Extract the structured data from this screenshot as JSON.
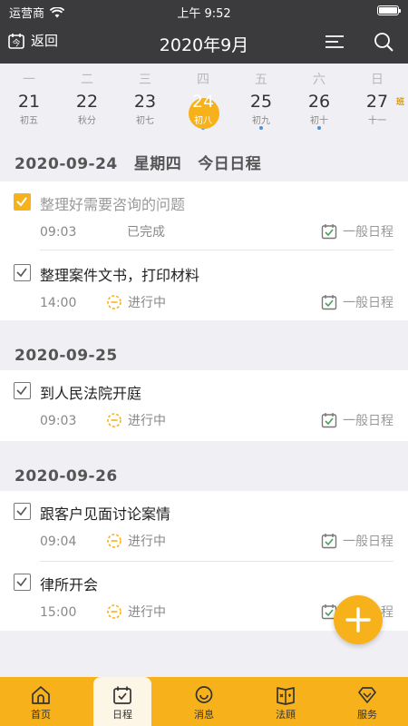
{
  "status": {
    "carrier": "运营商",
    "time": "上午 9:52"
  },
  "nav": {
    "back_label": "返回",
    "title": "2020年9月"
  },
  "week": {
    "days": [
      {
        "weekday": "一",
        "num": "21",
        "lunar": "初五"
      },
      {
        "weekday": "二",
        "num": "22",
        "lunar": "秋分"
      },
      {
        "weekday": "三",
        "num": "23",
        "lunar": "初七"
      },
      {
        "weekday": "四",
        "num": "24",
        "lunar": "初八"
      },
      {
        "weekday": "五",
        "num": "25",
        "lunar": "初九"
      },
      {
        "weekday": "六",
        "num": "26",
        "lunar": "初十"
      },
      {
        "weekday": "日",
        "num": "27",
        "lunar": "十一",
        "badge": "班"
      }
    ]
  },
  "sections": [
    {
      "date": "2020-09-24",
      "weekday": "星期四",
      "note": "今日日程",
      "items": [
        {
          "title": "整理好需要咨询的问题",
          "time": "09:03",
          "status": "已完成",
          "type": "一般日程"
        },
        {
          "title": "整理案件文书，打印材料",
          "time": "14:00",
          "status": "进行中",
          "type": "一般日程"
        }
      ]
    },
    {
      "date": "2020-09-25",
      "items": [
        {
          "title": "到人民法院开庭",
          "time": "09:03",
          "status": "进行中",
          "type": "一般日程"
        }
      ]
    },
    {
      "date": "2020-09-26",
      "items": [
        {
          "title": "跟客户见面讨论案情",
          "time": "09:04",
          "status": "进行中",
          "type": "一般日程"
        },
        {
          "title": "律所开会",
          "time": "15:00",
          "status": "进行中",
          "type": "一般日程"
        }
      ]
    }
  ],
  "tabs": [
    {
      "label": "首页"
    },
    {
      "label": "日程"
    },
    {
      "label": "消息"
    },
    {
      "label": "法頋"
    },
    {
      "label": "服务"
    }
  ],
  "colors": {
    "accent": "#f7b21b",
    "header": "#3b3b3d",
    "dot": "#4a90d9"
  }
}
